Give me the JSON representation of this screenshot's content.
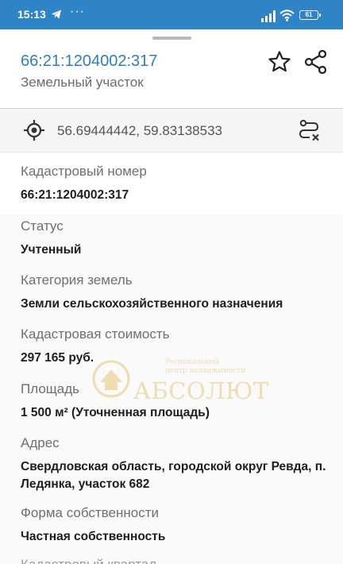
{
  "statusbar": {
    "time": "15:13",
    "dots": "···",
    "battery": "61"
  },
  "header": {
    "title": "66:21:1204002:317",
    "subtitle": "Земельный участок"
  },
  "coords": {
    "text": "56.69444442, 59.83138533"
  },
  "fields": [
    {
      "label": "Кадастровый номер",
      "value": "66:21:1204002:317"
    },
    {
      "label": "Статус",
      "value": "Учтенный"
    },
    {
      "label": "Категория земель",
      "value": "Земли сельскохозяйственного назначения"
    },
    {
      "label": "Кадастровая стоимость",
      "value": "297 165 руб."
    },
    {
      "label": "Площадь",
      "value": "1 500 м² (Уточненная площадь)"
    },
    {
      "label": "Адрес",
      "value": "Свердловская область, городской округ Ревда, п. Ледянка, участок 682"
    },
    {
      "label": "Форма собственности",
      "value": "Частная собственность"
    }
  ],
  "next_label": "Кадастровый квартал",
  "watermark": {
    "line1": "Региональный",
    "line2": "центр недвижимости",
    "name": "АБСОЛЮТ"
  },
  "colors": {
    "statusbar": "#2f83c7",
    "link": "#2f7fb8",
    "watermark": "#d4a51c"
  },
  "icons": [
    "telegram-icon",
    "signal-icon",
    "wifi-icon",
    "battery-icon",
    "star-icon",
    "share-icon",
    "locate-icon",
    "route-icon"
  ]
}
